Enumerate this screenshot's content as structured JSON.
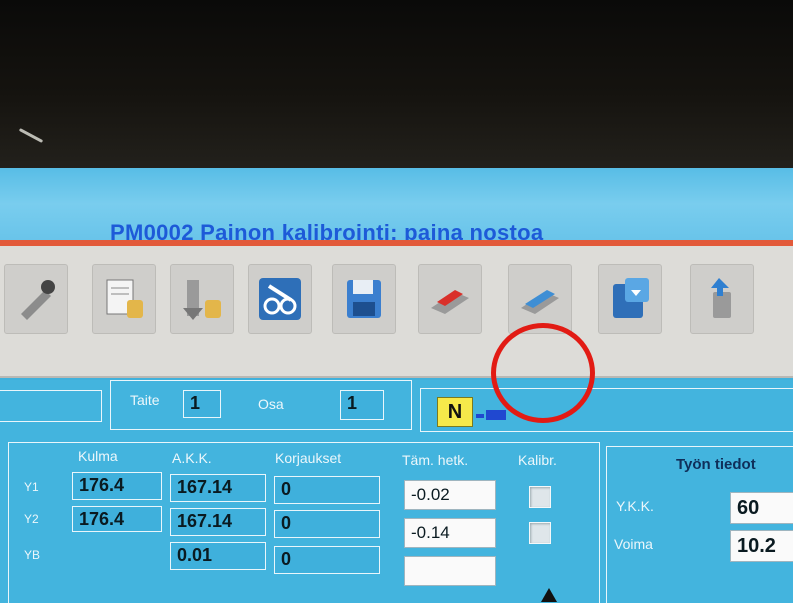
{
  "window": {
    "title": "PM0002 Painon kalibrointi: paina nostoa"
  },
  "toolbar": {
    "buttons": [
      {
        "icon": "tool-press-icon"
      },
      {
        "icon": "document-stack-icon"
      },
      {
        "icon": "import-tools-icon"
      },
      {
        "icon": "settings-wrench-icon"
      },
      {
        "icon": "save-disk-icon"
      },
      {
        "icon": "bend-red-icon"
      },
      {
        "icon": "bend-blue-icon"
      },
      {
        "icon": "export-disk-icon"
      },
      {
        "icon": "recycle-bin-icon"
      }
    ]
  },
  "header": {
    "taite_label": "Taite",
    "taite_value": "1",
    "osa_label": "Osa",
    "osa_value": "1",
    "mode_badge": "N"
  },
  "table": {
    "columns": [
      "Kulma",
      "A.K.K.",
      "Korjaukset",
      "Täm. hetk.",
      "Kalibr."
    ],
    "rows": [
      {
        "label": "Y1",
        "kulma": "176.4",
        "akk": "167.14",
        "korjaukset": "0",
        "tam_hetk": "-0.02"
      },
      {
        "label": "Y2",
        "kulma": "176.4",
        "akk": "167.14",
        "korjaukset": "0",
        "tam_hetk": "-0.14"
      },
      {
        "label": "YB",
        "kulma": "",
        "akk": "0.01",
        "korjaukset": "0"
      }
    ]
  },
  "tyon_tiedot": {
    "title": "Työn tiedot",
    "ykk_label": "Y.K.K.",
    "ykk_value": "60",
    "voima_label": "Voima",
    "voima_value": "10.2"
  },
  "colors": {
    "highlight_ring": "#e21b14",
    "title_text": "#1d5ad8",
    "panel_bg": "#43b4de"
  }
}
